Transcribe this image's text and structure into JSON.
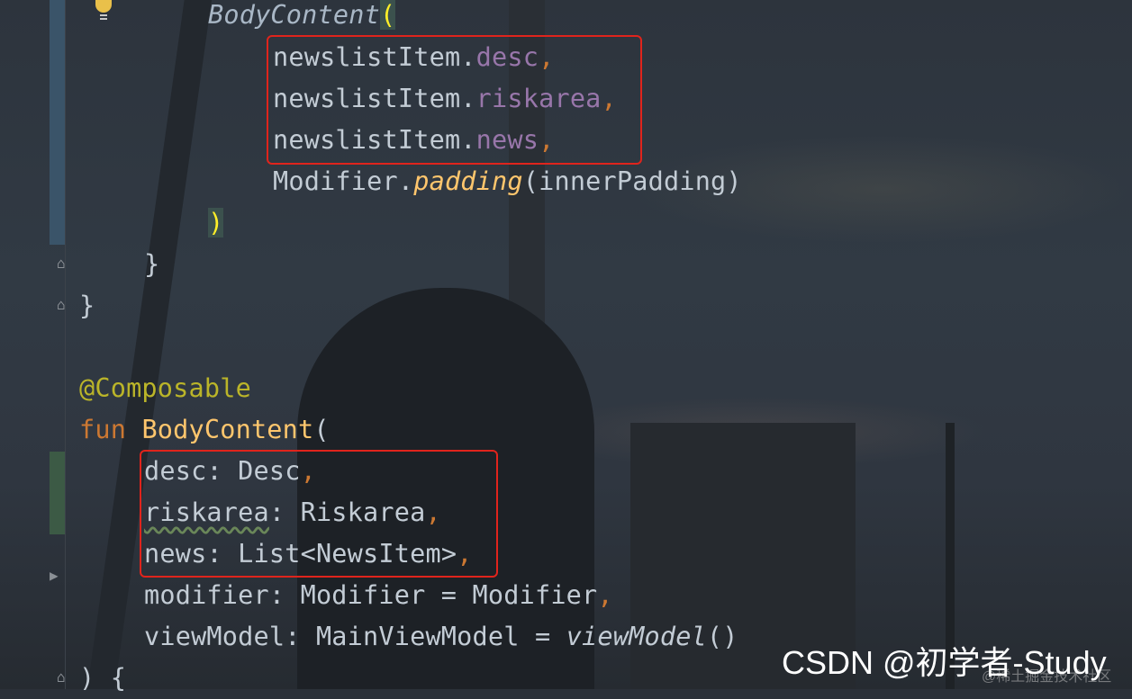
{
  "code": {
    "lines": [
      {
        "parts": [
          "BodyContent",
          "("
        ]
      },
      {
        "parts": [
          "newslistItem.",
          "desc",
          ","
        ]
      },
      {
        "parts": [
          "newslistItem.",
          "riskarea",
          ","
        ]
      },
      {
        "parts": [
          "newslistItem.",
          "news",
          ","
        ]
      },
      {
        "parts": [
          "Modifier.",
          "padding",
          "(innerPadding)"
        ]
      },
      {
        "parts": [
          ")"
        ]
      },
      {
        "parts": [
          "}"
        ]
      },
      {
        "parts": [
          "}"
        ]
      },
      {
        "parts": [
          "@Composable"
        ]
      },
      {
        "parts": [
          "fun",
          " ",
          "BodyContent",
          "("
        ]
      },
      {
        "parts": [
          "desc",
          ": Desc",
          ","
        ]
      },
      {
        "parts": [
          "riskarea",
          ": Riskarea",
          ","
        ]
      },
      {
        "parts": [
          "news",
          ": List<NewsItem>",
          ","
        ]
      },
      {
        "parts": [
          "modifier: Modifier = Modifier",
          ","
        ]
      },
      {
        "parts": [
          "viewModel: MainViewModel = ",
          "viewModel",
          "()"
        ]
      },
      {
        "parts": [
          ") {"
        ]
      }
    ]
  },
  "watermark": {
    "main": "CSDN @初学者-Study",
    "sub": "@稀土掘金技术社区"
  },
  "colors": {
    "keyword": "#cc7832",
    "property": "#9876aa",
    "annotation": "#bbb529",
    "function": "#ffc66d",
    "highlight_box": "#e0241c"
  },
  "icons": [
    "lightbulb-icon",
    "fold-icon",
    "run-gutter-icon"
  ]
}
